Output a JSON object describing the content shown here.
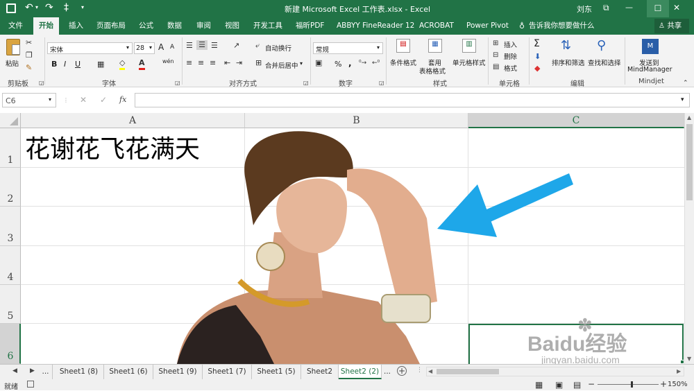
{
  "title_bar": {
    "title": "新建 Microsoft Excel 工作表.xlsx  -  Excel",
    "user": "刘东",
    "qat_more": "‡",
    "controls": {
      "restore": "⧉",
      "minimize": "—",
      "maximize": "☐",
      "close": "✕"
    }
  },
  "tabs": [
    "文件",
    "开始",
    "插入",
    "页面布局",
    "公式",
    "数据",
    "审阅",
    "视图",
    "开发工具",
    "福昕PDF",
    "ABBYY FineReader 12",
    "ACROBAT",
    "Power Pivot"
  ],
  "tell_me": "告诉我你想要做什么",
  "share": "共享",
  "ribbon": {
    "clipboard": {
      "paste": "粘贴",
      "label": "剪贴板"
    },
    "font": {
      "name": "宋体",
      "size": "28",
      "bold": "B",
      "italic": "I",
      "underline": "U",
      "grow": "A",
      "shrink": "A",
      "wen": "wén",
      "label": "字体"
    },
    "alignment": {
      "wrap": "自动换行",
      "merge": "合并后居中",
      "label": "对齐方式"
    },
    "number": {
      "format": "常规",
      "percent": "%",
      "comma": ",",
      "label": "数字"
    },
    "styles": {
      "conditional": "条件格式",
      "table_format_1": "套用",
      "table_format_2": "表格格式",
      "cell_style": "单元格样式",
      "label": "样式"
    },
    "cells": {
      "insert": "插入",
      "delete": "删除",
      "format": "格式",
      "label": "单元格"
    },
    "editing": {
      "sum": "Σ",
      "sort_filter": "排序和筛选",
      "find_select": "查找和选择",
      "label": "编辑"
    },
    "mindjet": {
      "send_1": "发送到",
      "send_2": "MindManager",
      "label": "Mindjet"
    }
  },
  "formula_bar": {
    "name_box": "C6",
    "fx": "fx",
    "value": ""
  },
  "columns": [
    "A",
    "B",
    "C"
  ],
  "rows": [
    "1",
    "2",
    "3",
    "4",
    "5",
    "6"
  ],
  "cells": {
    "A1": "花谢花飞花满天"
  },
  "sheet_tabs": [
    "...",
    "Sheet1 (8)",
    "Sheet1 (6)",
    "Sheet1 (9)",
    "Sheet1 (7)",
    "Sheet1 (5)",
    "Sheet2",
    "Sheet2 (2)",
    "..."
  ],
  "active_sheet": "Sheet2 (2)",
  "status": {
    "mode": "就绪",
    "zoom": "150%"
  },
  "watermark": {
    "brand": "Baidu经验",
    "url": "jingyan.baidu.com"
  },
  "colors": {
    "excel_green": "#217346",
    "arrow_blue": "#1ea7e9"
  }
}
